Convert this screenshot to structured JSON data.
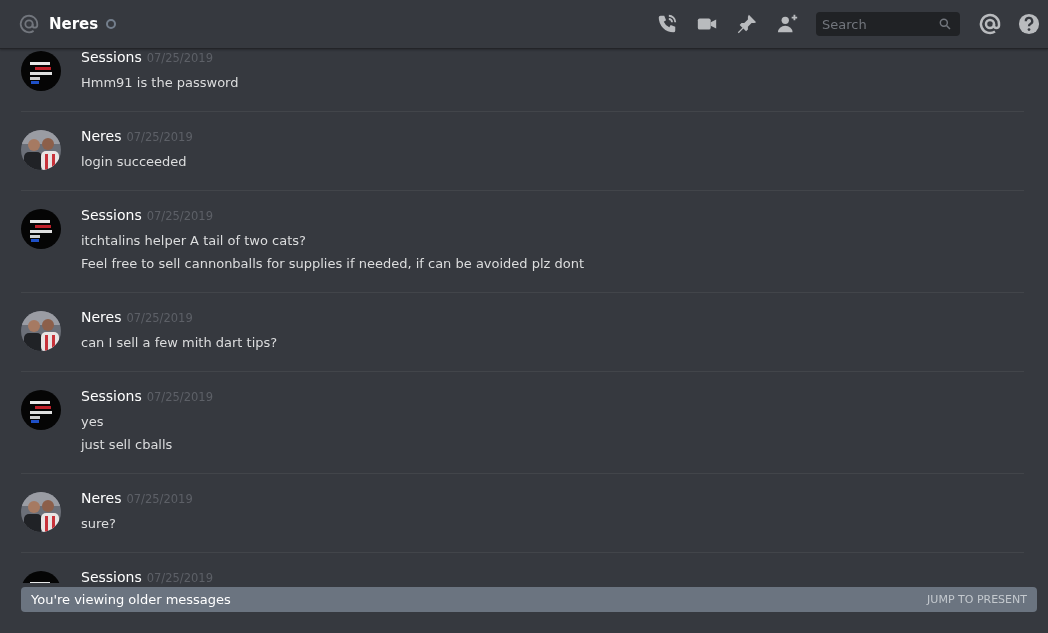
{
  "header": {
    "channel": "Neres",
    "online": false,
    "search": {
      "placeholder": "Search"
    }
  },
  "messages": [
    {
      "author": "Sessions",
      "date": "07/25/2019",
      "lines": [
        "Hmm91 is the password"
      ]
    },
    {
      "author": "Neres",
      "date": "07/25/2019",
      "lines": [
        "login succeeded"
      ]
    },
    {
      "author": "Sessions",
      "date": "07/25/2019",
      "lines": [
        "itchtalins helper A tail of two cats?",
        "Feel free to sell cannonballs for supplies if needed, if can be avoided plz dont"
      ]
    },
    {
      "author": "Neres",
      "date": "07/25/2019",
      "lines": [
        "can I sell a few mith dart tips?"
      ]
    },
    {
      "author": "Sessions",
      "date": "07/25/2019",
      "lines": [
        "yes",
        "just sell cballs"
      ]
    },
    {
      "author": "Neres",
      "date": "07/25/2019",
      "lines": [
        "sure?"
      ]
    },
    {
      "author": "Sessions",
      "date": "07/25/2019"
    }
  ],
  "notice": {
    "text": "You're viewing older messages",
    "action": "JUMP TO PRESENT"
  }
}
